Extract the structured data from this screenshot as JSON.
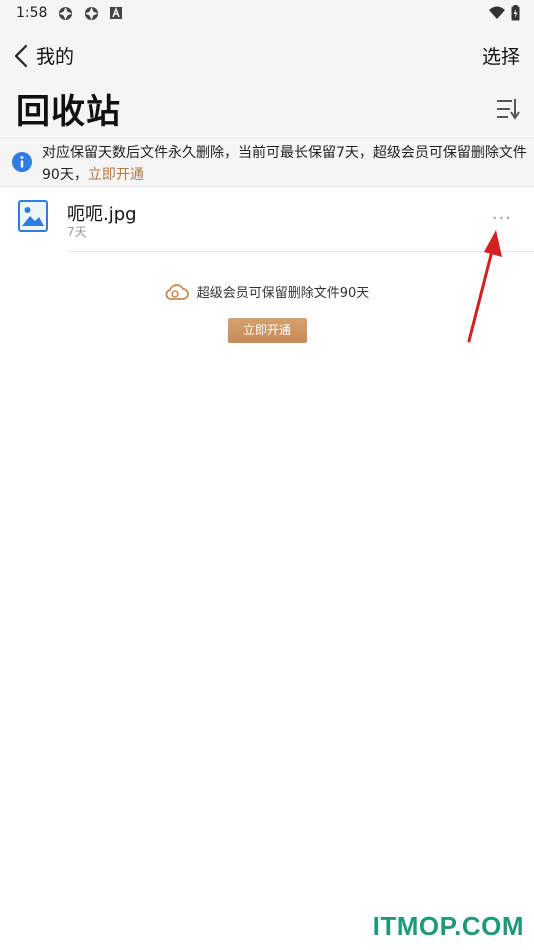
{
  "status_bar": {
    "time": "1:58",
    "icons": [
      "app-notification-icon",
      "app-notification-icon",
      "text-notification-icon",
      "wifi-icon",
      "battery-icon"
    ]
  },
  "header": {
    "back_label": "我的",
    "select_label": "选择",
    "title": "回收站"
  },
  "notice": {
    "text": "对应保留天数后文件永久删除，当前可最长保留7天，超级会员可保留删除文件90天，",
    "link": "立即开通"
  },
  "files": [
    {
      "name": "呃呃.jpg",
      "age": "7天",
      "type": "image"
    }
  ],
  "promo": {
    "text": "超级会员可保留删除文件90天",
    "button_label": "立即开通"
  },
  "watermark": "ITMOP.COM",
  "colors": {
    "accent_link": "#b07a46",
    "button": "#cc9461",
    "info_blue": "#2f7de1",
    "image_icon": "#2f7de1",
    "annotation_arrow": "#d42020",
    "watermark": "#1e9a7a"
  }
}
